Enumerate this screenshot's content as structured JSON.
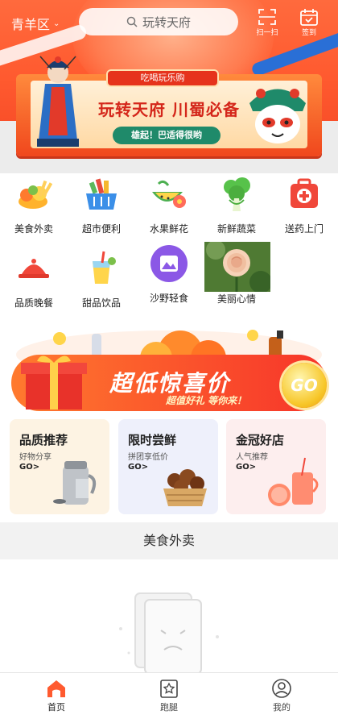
{
  "header": {
    "city": "青羊区",
    "search_placeholder": "玩转天府",
    "scan_label": "扫一扫",
    "signin_label": "签到"
  },
  "banner": {
    "tag": "吃喝玩乐购",
    "title": "玩转天府 川蜀必备",
    "subtitle": "雄起！巴适得很哟"
  },
  "categories": [
    {
      "label": "美食外卖",
      "icon": "food-delivery-icon"
    },
    {
      "label": "超市便利",
      "icon": "shopping-basket-icon"
    },
    {
      "label": "水果鲜花",
      "icon": "fruit-icon"
    },
    {
      "label": "新鲜蔬菜",
      "icon": "vegetable-icon"
    },
    {
      "label": "送药上门",
      "icon": "medicine-box-icon"
    },
    {
      "label": "品质晚餐",
      "icon": "dinner-cloche-icon"
    },
    {
      "label": "甜品饮品",
      "icon": "drink-icon"
    },
    {
      "label": "沙野轻食",
      "icon": "mountain-photo-icon"
    },
    {
      "label": "美丽心情",
      "icon": "rose-photo"
    }
  ],
  "promo": {
    "title": "超低惊喜价",
    "subtitle": "超值好礼 等你来！",
    "go": "GO"
  },
  "cards": [
    {
      "title": "品质推荐",
      "subtitle": "好物分享",
      "go": "GO>",
      "bg": "#fdf3e3"
    },
    {
      "title": "限时尝鲜",
      "subtitle": "拼团享低价",
      "go": "GO>",
      "bg": "#eef0fb"
    },
    {
      "title": "金冠好店",
      "subtitle": "人气推荐",
      "go": "GO>",
      "bg": "#fdeeee"
    }
  ],
  "section_title": "美食外卖",
  "tabs": [
    {
      "label": "首页",
      "icon": "home-icon",
      "active": true
    },
    {
      "label": "跑腿",
      "icon": "errand-star-icon",
      "active": false
    },
    {
      "label": "我的",
      "icon": "profile-icon",
      "active": false
    }
  ],
  "colors": {
    "accent": "#ff5a2f",
    "tab_active": "#ff5a2f"
  }
}
